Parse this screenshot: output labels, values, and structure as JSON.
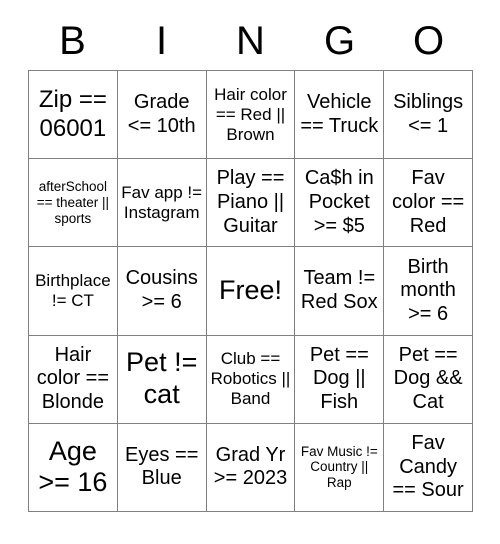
{
  "card": {
    "headers": [
      "B",
      "I",
      "N",
      "G",
      "O"
    ],
    "rows": [
      [
        {
          "text": "Zip == 06001",
          "size": "lg"
        },
        {
          "text": "Grade <= 10th",
          "size": "md"
        },
        {
          "text": "Hair color == Red || Brown",
          "size": "sm"
        },
        {
          "text": "Vehicle == Truck",
          "size": "md"
        },
        {
          "text": "Siblings <= 1",
          "size": "md"
        }
      ],
      [
        {
          "text": "afterSchool == theater || sports",
          "size": "xs"
        },
        {
          "text": "Fav app != Instagram",
          "size": "sm"
        },
        {
          "text": "Play == Piano || Guitar",
          "size": "md"
        },
        {
          "text": "Ca$h in Pocket >= $5",
          "size": "md"
        },
        {
          "text": "Fav color == Red",
          "size": "md"
        }
      ],
      [
        {
          "text": "Birthplace != CT",
          "size": "sm"
        },
        {
          "text": "Cousins >= 6",
          "size": "md"
        },
        {
          "text": "Free!",
          "size": "xl"
        },
        {
          "text": "Team != Red Sox",
          "size": "md"
        },
        {
          "text": "Birth month >= 6",
          "size": "md"
        }
      ],
      [
        {
          "text": "Hair color == Blonde",
          "size": "md"
        },
        {
          "text": "Pet != cat",
          "size": "xl"
        },
        {
          "text": "Club == Robotics || Band",
          "size": "sm"
        },
        {
          "text": "Pet == Dog || Fish",
          "size": "md"
        },
        {
          "text": "Pet == Dog && Cat",
          "size": "md"
        }
      ],
      [
        {
          "text": "Age >= 16",
          "size": "xl"
        },
        {
          "text": "Eyes == Blue",
          "size": "md"
        },
        {
          "text": "Grad Yr >= 2023",
          "size": "md"
        },
        {
          "text": "Fav Music != Country || Rap",
          "size": "xs"
        },
        {
          "text": "Fav Candy == Sour",
          "size": "md"
        }
      ]
    ]
  }
}
